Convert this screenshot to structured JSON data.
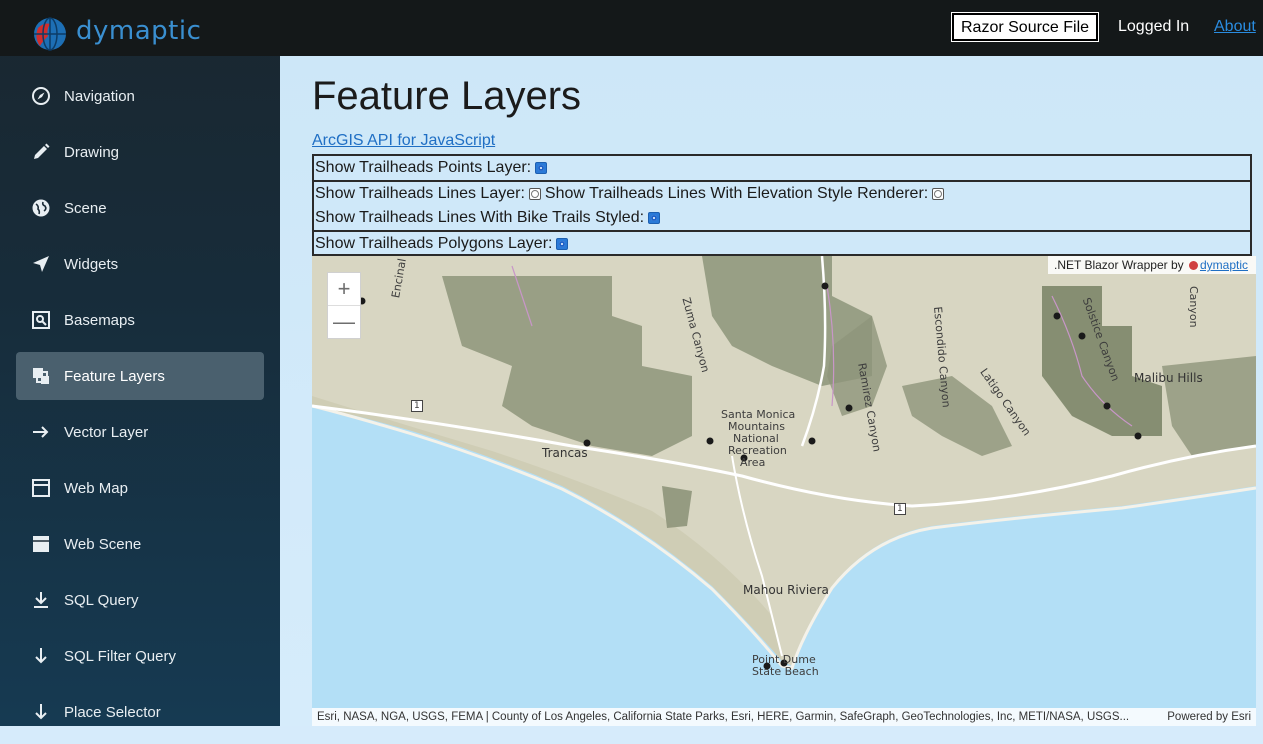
{
  "brand": {
    "name": "dymaptic"
  },
  "header": {
    "source_button": "Razor Source File",
    "logged_in": "Logged In",
    "about": "About"
  },
  "sidebar": {
    "items": [
      {
        "label": "Navigation",
        "icon": "compass-icon"
      },
      {
        "label": "Drawing",
        "icon": "pencil-icon"
      },
      {
        "label": "Scene",
        "icon": "globe-icon"
      },
      {
        "label": "Widgets",
        "icon": "location-arrow-icon"
      },
      {
        "label": "Basemaps",
        "icon": "basemap-icon"
      },
      {
        "label": "Feature Layers",
        "icon": "layers-icon",
        "active": true
      },
      {
        "label": "Vector Layer",
        "icon": "arrow-right-icon"
      },
      {
        "label": "Web Map",
        "icon": "browser-window-icon"
      },
      {
        "label": "Web Scene",
        "icon": "browser-window-filled-icon"
      },
      {
        "label": "SQL Query",
        "icon": "download-icon"
      },
      {
        "label": "SQL Filter Query",
        "icon": "arrow-down-icon"
      },
      {
        "label": "Place Selector",
        "icon": "arrow-down-icon"
      }
    ]
  },
  "main": {
    "title": "Feature Layers",
    "api_link": "ArcGIS API for JavaScript",
    "options": {
      "points": {
        "label": "Show Trailheads Points Layer:",
        "checked": true
      },
      "lines": {
        "label": "Show Trailheads Lines Layer:",
        "checked": false
      },
      "elevation": {
        "label": "Show Trailheads Lines With Elevation Style Renderer:",
        "checked": false
      },
      "bike": {
        "label": "Show Trailheads Lines With Bike Trails Styled:",
        "checked": true
      },
      "polygons": {
        "label": "Show Trailheads Polygons Layer:",
        "checked": true
      }
    }
  },
  "map": {
    "zoom_in": "+",
    "zoom_out": "—",
    "wrapper_credit_prefix": ".NET Blazor Wrapper by",
    "wrapper_credit_link": "dymaptic",
    "attribution": "Esri, NASA, NGA, USGS, FEMA | County of Los Angeles, California State Parks, Esri, HERE, Garmin, SafeGraph, GeoTechnologies, Inc, METI/NASA, USGS...",
    "powered_by": "Powered by Esri",
    "labels": {
      "trancas": "Trancas",
      "smm_1": "Santa Monica",
      "smm_2": "Mountains",
      "smm_3": "National",
      "smm_4": "Recreation",
      "smm_5": "Area",
      "malibu_hills": "Malibu Hills",
      "mahou": "Mahou Riviera",
      "point_dume_1": "Point Dume",
      "point_dume_2": "State Beach",
      "hwy1_a": "1",
      "hwy1_b": "1",
      "zuma": "Zuma Canyon",
      "ramirez": "Ramirez Canyon",
      "latigo": "Latigo Canyon",
      "escondido": "Escondido Canyon",
      "solstice": "Solstice Canyon",
      "encinal": "Encinal Canyon",
      "corral": "Canyon"
    }
  }
}
